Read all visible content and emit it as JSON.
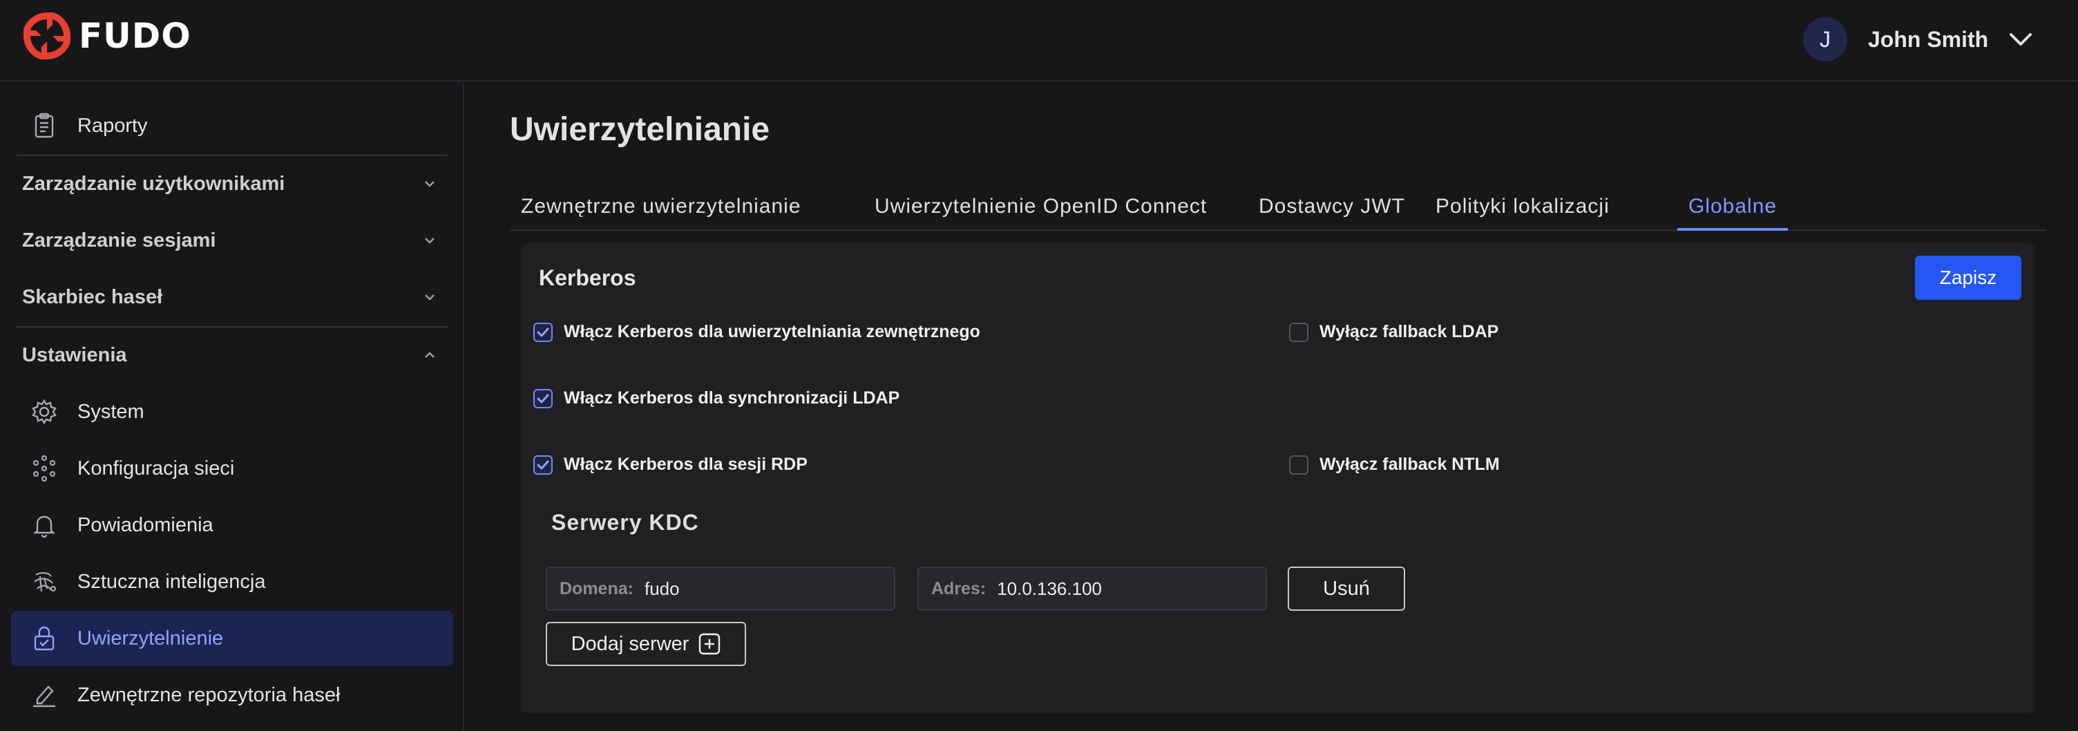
{
  "brand": {
    "name": "FUDO",
    "accent": "#e8402f"
  },
  "user": {
    "initial": "J",
    "name": "John Smith"
  },
  "sidebar": {
    "reports": {
      "label": "Raporty",
      "icon": "clipboard-icon"
    },
    "groups": {
      "users": "Zarządzanie użytkownikami",
      "sessions": "Zarządzanie sesjami",
      "vault": "Skarbiec haseł",
      "settings": "Ustawienia"
    },
    "settings_items": {
      "system": "System",
      "network": "Konfiguracja sieci",
      "notifications": "Powiadomienia",
      "ai": "Sztuczna inteligencja",
      "auth": "Uwierzytelnienie",
      "external_repos": "Zewnętrzne repozytoria haseł"
    }
  },
  "page": {
    "title": "Uwierzytelnianie"
  },
  "tabs": {
    "external": "Zewnętrzne uwierzytelnianie",
    "openid": "Uwierzytelnienie OpenID Connect",
    "jwt": "Dostawcy JWT",
    "location": "Polityki lokalizacji",
    "global": "Globalne",
    "active": "Globalne"
  },
  "kerberos": {
    "title": "Kerberos",
    "save_label": "Zapisz",
    "options": {
      "external": {
        "label": "Włącz Kerberos dla uwierzytelniania zewnętrznego",
        "checked": true
      },
      "ldap_sync": {
        "label": "Włącz Kerberos dla synchronizacji LDAP",
        "checked": true
      },
      "rdp": {
        "label": "Włącz Kerberos dla sesji RDP",
        "checked": true
      },
      "ldap_fallback": {
        "label": "Wyłącz fallback LDAP",
        "checked": false
      },
      "ntlm_fallback": {
        "label": "Wyłącz fallback NTLM",
        "checked": false
      }
    }
  },
  "kdc": {
    "title": "Serwery KDC",
    "domain_label": "Domena:",
    "domain_value": "fudo",
    "address_label": "Adres:",
    "address_value": "10.0.136.100",
    "remove_label": "Usuń",
    "add_label": "Dodaj serwer"
  }
}
